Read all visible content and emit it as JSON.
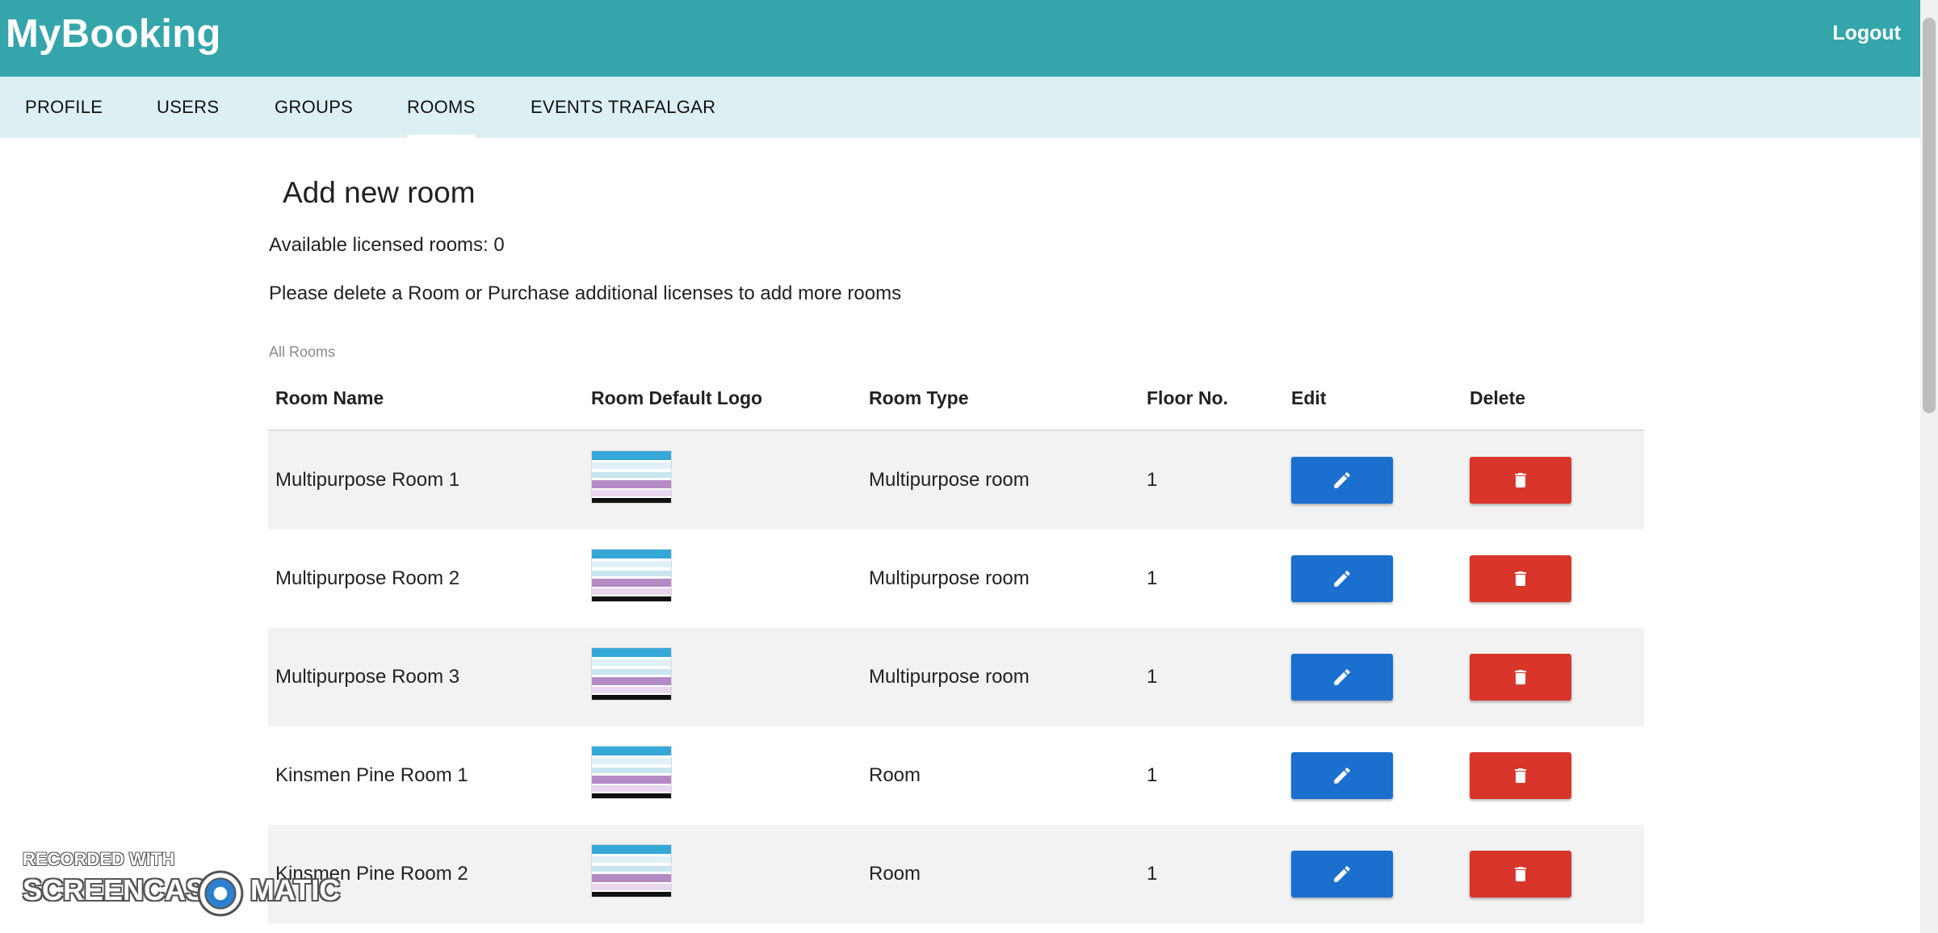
{
  "header": {
    "brand": "MyBooking",
    "logout_label": "Logout"
  },
  "nav": {
    "tabs": [
      {
        "label": "PROFILE"
      },
      {
        "label": "USERS"
      },
      {
        "label": "GROUPS"
      },
      {
        "label": "ROOMS",
        "active": true
      },
      {
        "label": "EVENTS TRAFALGAR"
      }
    ]
  },
  "main": {
    "title": "Add new room",
    "available_text": "Available licensed rooms: 0",
    "notice_text": "Please delete a Room or Purchase additional licenses to add more rooms",
    "section_label": "All Rooms"
  },
  "table": {
    "headers": [
      "Room Name",
      "Room Default Logo",
      "Room Type",
      "Floor No.",
      "Edit",
      "Delete"
    ],
    "rows": [
      {
        "name": "Multipurpose Room 1",
        "type": "Multipurpose room",
        "floor": "1"
      },
      {
        "name": "Multipurpose Room 2",
        "type": "Multipurpose room",
        "floor": "1"
      },
      {
        "name": "Multipurpose Room 3",
        "type": "Multipurpose room",
        "floor": "1"
      },
      {
        "name": "Kinsmen Pine Room 1",
        "type": "Room",
        "floor": "1"
      },
      {
        "name": "Kinsmen Pine Room 2",
        "type": "Room",
        "floor": "1"
      }
    ]
  },
  "icons": {
    "edit": "pencil-icon",
    "delete": "trash-icon"
  },
  "colors": {
    "header_bg": "#33a5ab",
    "nav_bg": "#dcf0f4",
    "edit_button": "#1a6fcf",
    "delete_button": "#d9352a",
    "row_shade": "#f2f2f2"
  },
  "watermark": {
    "line1": "RECORDED WITH",
    "left": "SCREENCAST",
    "right": "MATIC"
  }
}
